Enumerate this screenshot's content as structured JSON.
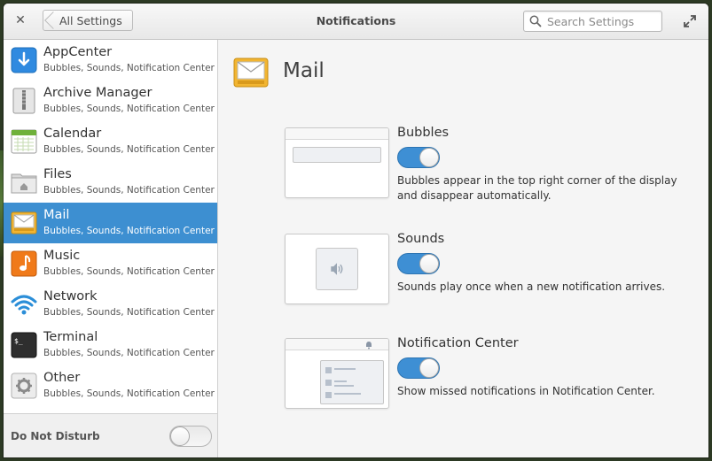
{
  "window": {
    "title": "Notifications",
    "back_label": "All Settings",
    "search_placeholder": "Search Settings",
    "close_icon": "close-icon",
    "maximize_icon": "maximize-icon"
  },
  "sidebar": {
    "items": [
      {
        "name": "AppCenter",
        "subtitle": "Bubbles, Sounds, Notification Center",
        "icon": "appcenter-icon",
        "selected": false
      },
      {
        "name": "Archive Manager",
        "subtitle": "Bubbles, Sounds, Notification Center",
        "icon": "archive-manager-icon",
        "selected": false
      },
      {
        "name": "Calendar",
        "subtitle": "Bubbles, Sounds, Notification Center",
        "icon": "calendar-icon",
        "selected": false
      },
      {
        "name": "Files",
        "subtitle": "Bubbles, Sounds, Notification Center",
        "icon": "files-icon",
        "selected": false
      },
      {
        "name": "Mail",
        "subtitle": "Bubbles, Sounds, Notification Center",
        "icon": "mail-icon",
        "selected": true
      },
      {
        "name": "Music",
        "subtitle": "Bubbles, Sounds, Notification Center",
        "icon": "music-icon",
        "selected": false
      },
      {
        "name": "Network",
        "subtitle": "Bubbles, Sounds, Notification Center",
        "icon": "network-icon",
        "selected": false
      },
      {
        "name": "Terminal",
        "subtitle": "Bubbles, Sounds, Notification Center",
        "icon": "terminal-icon",
        "selected": false
      },
      {
        "name": "Other",
        "subtitle": "Bubbles, Sounds, Notification Center",
        "icon": "other-gear-icon",
        "selected": false
      }
    ],
    "dnd": {
      "label": "Do Not Disturb",
      "enabled": false
    }
  },
  "content": {
    "app_title": "Mail",
    "app_icon": "mail-icon",
    "options": [
      {
        "title": "Bubbles",
        "enabled": true,
        "description": "Bubbles appear in the top right corner of the display and disappear automatically."
      },
      {
        "title": "Sounds",
        "enabled": true,
        "description": "Sounds play once when a new notification arrives."
      },
      {
        "title": "Notification Center",
        "enabled": true,
        "description": "Show missed notifications in Notification Center."
      }
    ]
  },
  "colors": {
    "selection": "#3d8fd1",
    "switch_on": "#3e8fd4"
  }
}
